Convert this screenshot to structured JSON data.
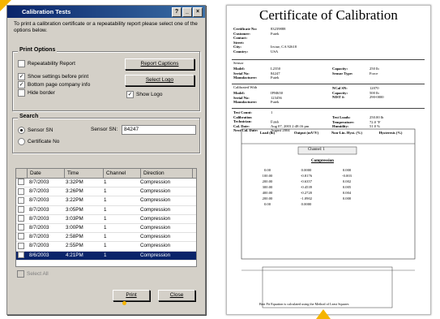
{
  "dialog": {
    "title": "Calibration Tests",
    "instructions": "To print a calibration certificate or a repeatability report please select one of the options below.",
    "print_options": {
      "title": "Print Options",
      "repeatability_report": "Repeatability Report",
      "show_settings": "Show settings before print",
      "bottom_page_company": "Bottom page company info",
      "hide_border": "Hide border",
      "report_captions_btn": "Report Captions",
      "select_logo_btn": "Select Logo",
      "show_logo": "Show Logo"
    },
    "search": {
      "title": "Search",
      "sensor_sn": "Sensor SN",
      "certificate_no": "Certificate No",
      "sensor_sn_label": "Sensor SN:",
      "sensor_sn_value": "84247"
    },
    "table": {
      "headers": [
        "Date",
        "Time",
        "Channel",
        "Direction"
      ],
      "rows": [
        [
          "8/7/2003",
          "3:32PM",
          "1",
          "Compression"
        ],
        [
          "8/7/2003",
          "3:26PM",
          "1",
          "Compression"
        ],
        [
          "8/7/2003",
          "3:22PM",
          "1",
          "Compression"
        ],
        [
          "8/7/2003",
          "3:05PM",
          "1",
          "Compression"
        ],
        [
          "8/7/2003",
          "3:03PM",
          "1",
          "Compression"
        ],
        [
          "8/7/2003",
          "3:00PM",
          "1",
          "Compression"
        ],
        [
          "8/7/2003",
          "2:58PM",
          "1",
          "Compression"
        ],
        [
          "8/7/2003",
          "2:55PM",
          "1",
          "Compression"
        ],
        [
          "8/6/2003",
          "4:21PM",
          "1",
          "Compression"
        ]
      ]
    },
    "select_all": "Select All",
    "print_btn": "Print",
    "close_btn": "Close"
  },
  "certificate": {
    "title": "Certificate of Calibration",
    "fields_left": [
      [
        "Certificate No:",
        "83239888"
      ],
      [
        "Customer:",
        "Futek"
      ],
      [
        "Contact:",
        ""
      ],
      [
        "Street:",
        ""
      ],
      [
        "City:",
        "Irvine, CA 92618"
      ],
      [
        "Country:",
        "USA"
      ]
    ],
    "sensor_label": "Sensor",
    "sensor_fields": [
      [
        "Model:",
        "L2350"
      ],
      [
        "Serial No:",
        "84247"
      ],
      [
        "Manufacturer:",
        "Futek"
      ]
    ],
    "sensor_right": [
      [
        "Capacity:",
        "250 lb"
      ],
      [
        "Sensor Type:",
        "Force"
      ]
    ],
    "instr_label": "Calibrated With",
    "instr_fields": [
      [
        "Model:",
        "IPM650"
      ],
      [
        "Serial No:",
        "123456"
      ],
      [
        "Manufacturer:",
        "Futek"
      ]
    ],
    "instr_right": [
      [
        "NCal SN:",
        "12070"
      ],
      [
        "Capacity:",
        "500 lb"
      ],
      [
        "NIST #:",
        "290-0000"
      ]
    ],
    "test_fields": [
      [
        "Test Count:",
        "1"
      ],
      [
        "Calibration Technician:",
        "Futek"
      ],
      [
        "Cal. Date:",
        "Aug 07, 2003 2:48:16 pm"
      ],
      [
        "Next Cal. Date:",
        "August 2004"
      ]
    ],
    "test_right": [
      [
        "Test Loads:",
        "250.00 lb"
      ],
      [
        "Temperature:",
        "72.0 °F"
      ],
      [
        "Humidity:",
        "51.0 %"
      ]
    ],
    "table_headers": [
      "Load (lb)",
      "Output (mV/V)",
      "Non-Lin. Hyst. (%)",
      "Hysteresis (%)"
    ],
    "channel_label": "Channel: 1",
    "compression_label": "Compression",
    "rows": [
      [
        "0.00",
        "0.0000",
        "0.000",
        ""
      ],
      [
        "100.00",
        "-0.8176",
        "-0.003",
        ""
      ],
      [
        "200.00",
        "-0.6357",
        "0.002",
        ""
      ],
      [
        "300.00",
        "-0.4539",
        "0.005",
        ""
      ],
      [
        "400.00",
        "-0.2720",
        "0.004",
        ""
      ],
      [
        "200.00",
        "-1.0902",
        "0.000",
        ""
      ],
      [
        "0.00",
        "0.0000",
        "",
        ""
      ]
    ],
    "equation_note": "Best Fit Equation is calculated using the Method of Least Squares"
  }
}
